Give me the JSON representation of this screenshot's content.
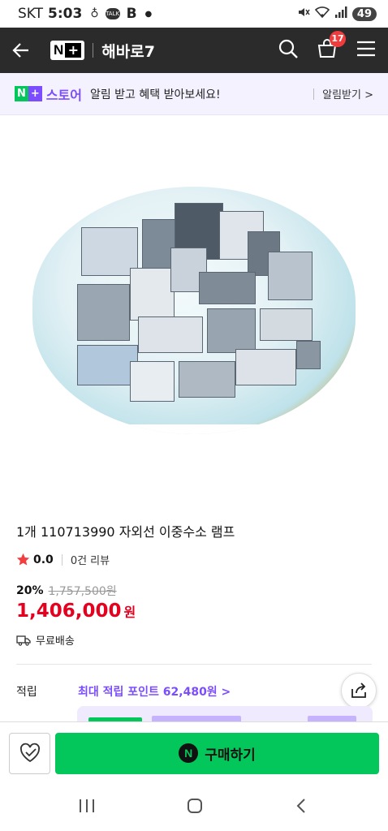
{
  "status": {
    "carrier": "SKT",
    "time": "5:03",
    "battery": "49"
  },
  "header": {
    "store_name": "해바로7",
    "cart_count": "17"
  },
  "notify": {
    "brand": "스토어",
    "message": "알림 받고 혜택 받아보세요!",
    "link": "알림받기 >"
  },
  "product": {
    "title": "1개 110713990 자외선 이중수소 램프",
    "rating": "0.0",
    "reviews": "0건 리뷰",
    "discount": "20%",
    "original_price": "1,757,500원",
    "price": "1,406,000",
    "price_unit": "원",
    "shipping": "무료배송"
  },
  "points": {
    "label": "적립",
    "value": "최대 적립 포인트 62,480원 >"
  },
  "buy": {
    "label": "구매하기"
  },
  "colors": {
    "naver_green": "#03c75a",
    "purple": "#7b4dff",
    "price_red": "#e6001f",
    "header_bg": "#2b2b2b"
  }
}
